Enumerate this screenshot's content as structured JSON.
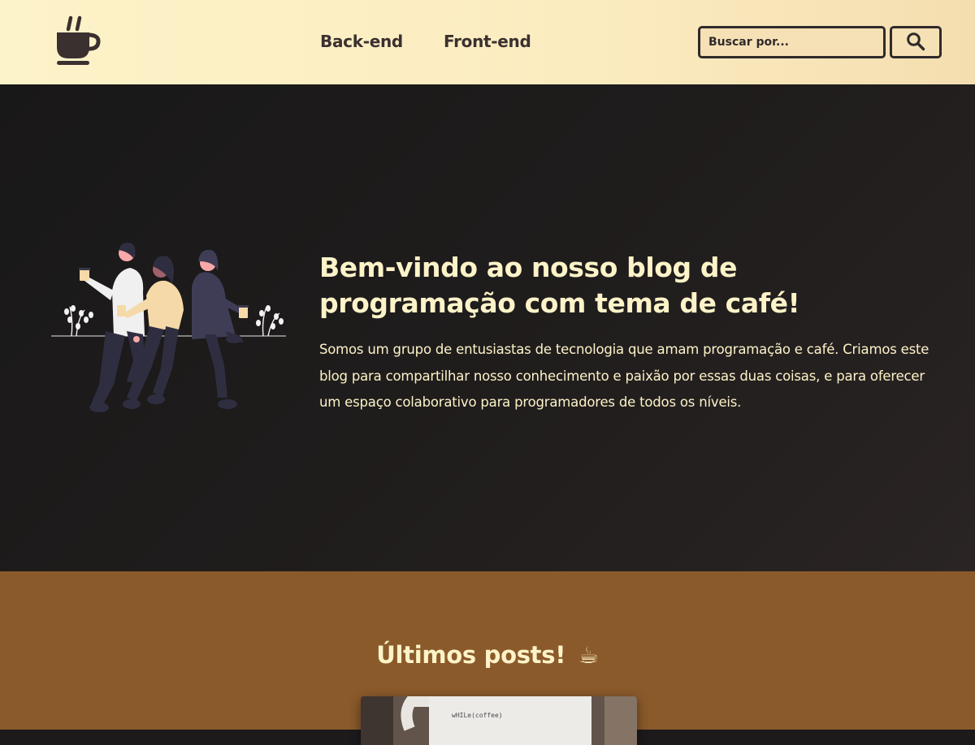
{
  "header": {
    "logo_icon": "coffee-cup-icon",
    "nav": [
      {
        "label": "Back-end"
      },
      {
        "label": "Front-end"
      }
    ],
    "search": {
      "placeholder": "Buscar por...",
      "value": "",
      "button_icon": "search-icon"
    }
  },
  "hero": {
    "title": "Bem-vindo ao nosso blog de programação com tema de café!",
    "text": "Somos um grupo de entusiastas de tecnologia que amam programação e café. Criamos este blog para compartilhar nosso conhecimento e paixão por essas duas coisas, e para oferecer um espaço colaborativo para programadores de todos os níveis.",
    "illustration": "three-people-drinking-coffee-illustration"
  },
  "posts": {
    "title": "Últimos posts!",
    "title_emoji": "☕"
  },
  "colors": {
    "header_bg": "#fdf3c8",
    "dark_text": "#3b3030",
    "hero_bg": "#1c1a1a",
    "cream": "#fdf3c8",
    "brown": "#8b5a2b"
  }
}
